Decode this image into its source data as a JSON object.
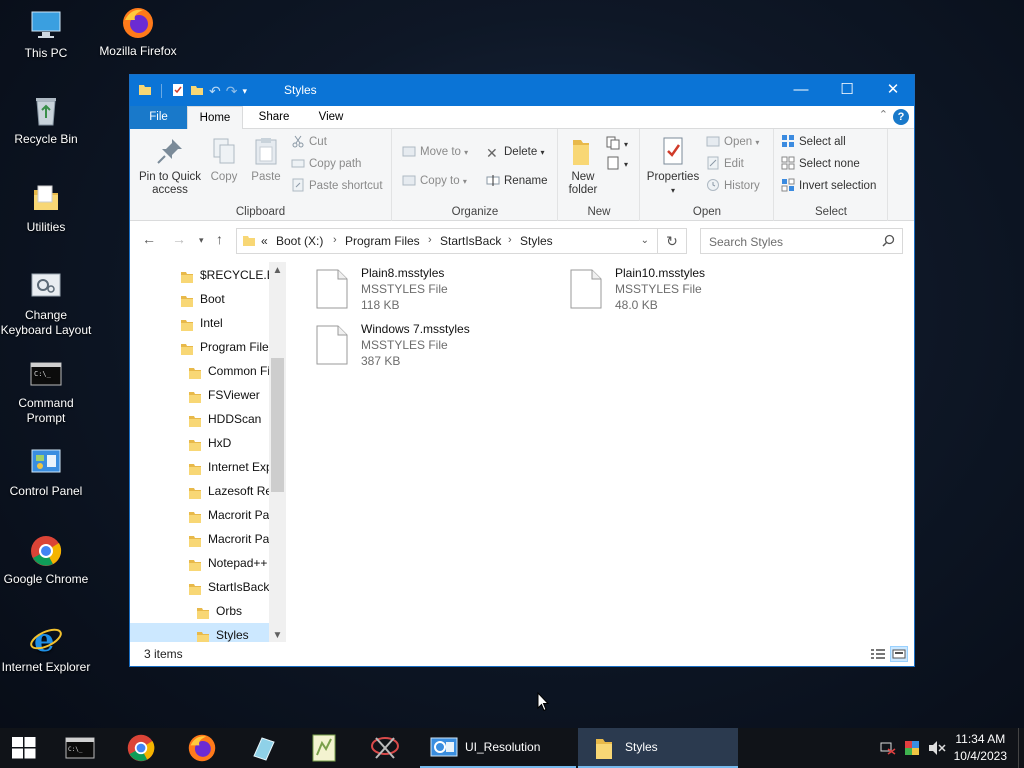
{
  "desktop": {
    "icons": [
      {
        "label": "This PC"
      },
      {
        "label": "Mozilla Firefox"
      },
      {
        "label": "Recycle Bin"
      },
      {
        "label": "Utilities"
      },
      {
        "label": "Change Keyboard Layout"
      },
      {
        "label": "Command Prompt"
      },
      {
        "label": "Control Panel"
      },
      {
        "label": "Google Chrome"
      },
      {
        "label": "Internet Explorer"
      }
    ]
  },
  "window": {
    "title": "Styles",
    "tabs": {
      "file": "File",
      "home": "Home",
      "share": "Share",
      "view": "View"
    },
    "ribbon": {
      "clipboard": {
        "label": "Clipboard",
        "pin": "Pin to Quick access",
        "copy": "Copy",
        "paste": "Paste",
        "cut": "Cut",
        "copy_path": "Copy path",
        "paste_shortcut": "Paste shortcut"
      },
      "organize": {
        "label": "Organize",
        "move_to": "Move to",
        "copy_to": "Copy to",
        "delete": "Delete",
        "rename": "Rename"
      },
      "new": {
        "label": "New",
        "new_folder": "New folder"
      },
      "open": {
        "label": "Open",
        "properties": "Properties",
        "open": "Open",
        "edit": "Edit",
        "history": "History"
      },
      "select": {
        "label": "Select",
        "select_all": "Select all",
        "select_none": "Select none",
        "invert_selection": "Invert selection"
      }
    },
    "address": {
      "overflow": "«",
      "crumbs": [
        "Boot (X:)",
        "Program Files",
        "StartIsBack",
        "Styles"
      ]
    },
    "search": {
      "placeholder": "Search Styles"
    },
    "nav_tree": [
      {
        "label": "$RECYCLE.BIN"
      },
      {
        "label": "Boot"
      },
      {
        "label": "Intel"
      },
      {
        "label": "Program Files"
      },
      {
        "label": "Common Files"
      },
      {
        "label": "FSViewer"
      },
      {
        "label": "HDDScan"
      },
      {
        "label": "HxD"
      },
      {
        "label": "Internet Explorer"
      },
      {
        "label": "Lazesoft Recovery"
      },
      {
        "label": "Macrorit Partition"
      },
      {
        "label": "Macrorit Partition"
      },
      {
        "label": "Notepad++"
      },
      {
        "label": "StartIsBack"
      },
      {
        "label": "Orbs"
      },
      {
        "label": "Styles"
      }
    ],
    "files": [
      {
        "name": "Plain8.msstyles",
        "type": "MSSTYLES File",
        "size": "118 KB"
      },
      {
        "name": "Plain10.msstyles",
        "type": "MSSTYLES File",
        "size": "48.0 KB"
      },
      {
        "name": "Windows 7.msstyles",
        "type": "MSSTYLES File",
        "size": "387 KB"
      }
    ],
    "status": {
      "items": "3 items"
    }
  },
  "taskbar": {
    "buttons": [
      {
        "label": "UI_Resolution"
      },
      {
        "label": "Styles"
      }
    ],
    "clock": {
      "time": "11:34 AM",
      "date": "10/4/2023"
    }
  },
  "colors": {
    "accent": "#0b74d6",
    "folder": "#f8d775",
    "taskbar": "#101318"
  }
}
